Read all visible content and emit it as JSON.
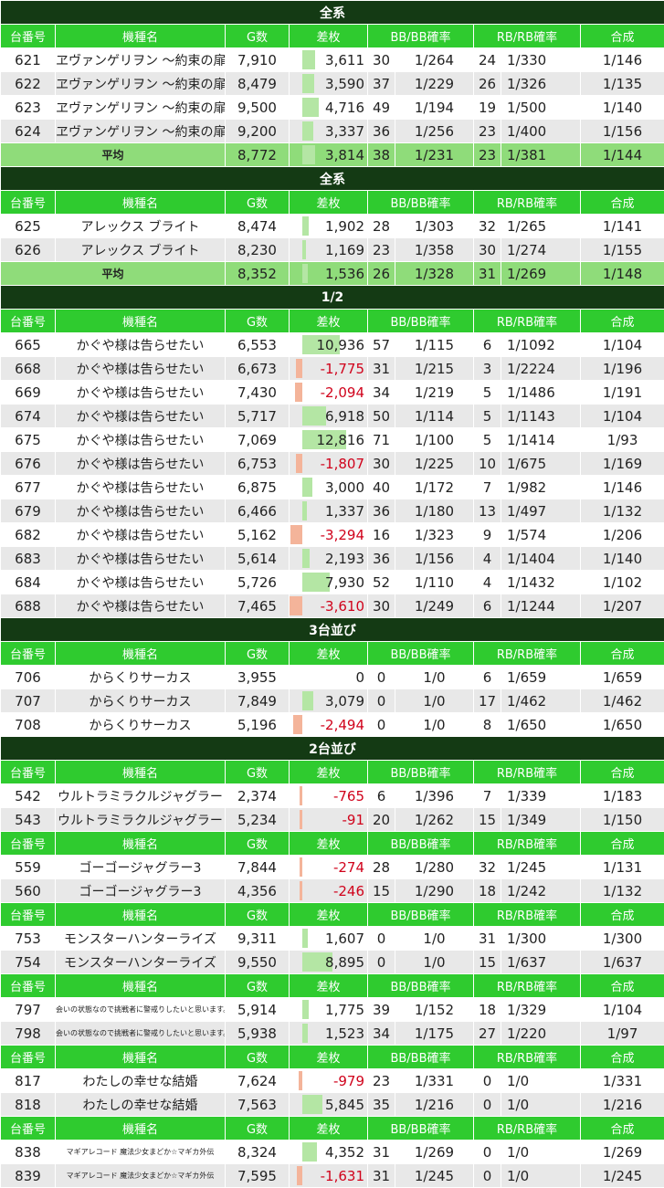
{
  "headers": [
    "台番号",
    "機種名",
    "G数",
    "差枚",
    "BB/BB確率",
    "RB/RB確率",
    "合成"
  ],
  "diff_scale_max": 12816,
  "sections": [
    {
      "title": "全系",
      "groups": [
        {
          "rows": [
            [
              "621",
              "ヱヴァンゲリヲン ～約束の扉～",
              "7,910",
              "3,611",
              "30",
              "1/264",
              "24",
              "1/330",
              "1/146"
            ],
            [
              "622",
              "ヱヴァンゲリヲン ～約束の扉～",
              "8,479",
              "3,590",
              "37",
              "1/229",
              "26",
              "1/326",
              "1/135"
            ],
            [
              "623",
              "ヱヴァンゲリヲン ～約束の扉～",
              "9,500",
              "4,716",
              "49",
              "1/194",
              "19",
              "1/500",
              "1/140"
            ],
            [
              "624",
              "ヱヴァンゲリヲン ～約束の扉～",
              "9,200",
              "3,337",
              "36",
              "1/256",
              "23",
              "1/400",
              "1/156"
            ]
          ]
        }
      ],
      "avg": [
        "平均",
        "8,772",
        "3,814",
        "38",
        "1/231",
        "23",
        "1/381",
        "1/144"
      ]
    },
    {
      "title": "全系",
      "groups": [
        {
          "rows": [
            [
              "625",
              "アレックス ブライト",
              "8,474",
              "1,902",
              "28",
              "1/303",
              "32",
              "1/265",
              "1/141"
            ],
            [
              "626",
              "アレックス ブライト",
              "8,230",
              "1,169",
              "23",
              "1/358",
              "30",
              "1/274",
              "1/155"
            ]
          ]
        }
      ],
      "avg": [
        "平均",
        "8,352",
        "1,536",
        "26",
        "1/328",
        "31",
        "1/269",
        "1/148"
      ]
    },
    {
      "title": "1/2",
      "groups": [
        {
          "rows": [
            [
              "665",
              "かぐや様は告らせたい",
              "6,553",
              "10,936",
              "57",
              "1/115",
              "6",
              "1/1092",
              "1/104"
            ],
            [
              "668",
              "かぐや様は告らせたい",
              "6,673",
              "-1,775",
              "31",
              "1/215",
              "3",
              "1/2224",
              "1/196"
            ],
            [
              "669",
              "かぐや様は告らせたい",
              "7,430",
              "-2,094",
              "34",
              "1/219",
              "5",
              "1/1486",
              "1/191"
            ],
            [
              "674",
              "かぐや様は告らせたい",
              "5,717",
              "6,918",
              "50",
              "1/114",
              "5",
              "1/1143",
              "1/104"
            ],
            [
              "675",
              "かぐや様は告らせたい",
              "7,069",
              "12,816",
              "71",
              "1/100",
              "5",
              "1/1414",
              "1/93"
            ],
            [
              "676",
              "かぐや様は告らせたい",
              "6,753",
              "-1,807",
              "30",
              "1/225",
              "10",
              "1/675",
              "1/169"
            ],
            [
              "677",
              "かぐや様は告らせたい",
              "6,875",
              "3,000",
              "40",
              "1/172",
              "7",
              "1/982",
              "1/146"
            ],
            [
              "679",
              "かぐや様は告らせたい",
              "6,466",
              "1,337",
              "36",
              "1/180",
              "13",
              "1/497",
              "1/132"
            ],
            [
              "682",
              "かぐや様は告らせたい",
              "5,162",
              "-3,294",
              "16",
              "1/323",
              "9",
              "1/574",
              "1/206"
            ],
            [
              "683",
              "かぐや様は告らせたい",
              "5,614",
              "2,193",
              "36",
              "1/156",
              "4",
              "1/1404",
              "1/140"
            ],
            [
              "684",
              "かぐや様は告らせたい",
              "5,726",
              "7,930",
              "52",
              "1/110",
              "4",
              "1/1432",
              "1/102"
            ],
            [
              "688",
              "かぐや様は告らせたい",
              "7,465",
              "-3,610",
              "30",
              "1/249",
              "6",
              "1/1244",
              "1/207"
            ]
          ]
        }
      ]
    },
    {
      "title": "3台並び",
      "groups": [
        {
          "rows": [
            [
              "706",
              "からくりサーカス",
              "3,955",
              "0",
              "0",
              "1/0",
              "6",
              "1/659",
              "1/659"
            ],
            [
              "707",
              "からくりサーカス",
              "7,849",
              "3,079",
              "0",
              "1/0",
              "17",
              "1/462",
              "1/462"
            ],
            [
              "708",
              "からくりサーカス",
              "5,196",
              "-2,494",
              "0",
              "1/0",
              "8",
              "1/650",
              "1/650"
            ]
          ]
        }
      ]
    },
    {
      "title": "2台並び",
      "groups": [
        {
          "rows": [
            [
              "542",
              "ウルトラミラクルジャグラー",
              "2,374",
              "-765",
              "6",
              "1/396",
              "7",
              "1/339",
              "1/183"
            ],
            [
              "543",
              "ウルトラミラクルジャグラー",
              "5,234",
              "-91",
              "20",
              "1/262",
              "15",
              "1/349",
              "1/150"
            ]
          ]
        },
        {
          "rows": [
            [
              "559",
              "ゴーゴージャグラー3",
              "7,844",
              "-274",
              "28",
              "1/280",
              "32",
              "1/245",
              "1/131"
            ],
            [
              "560",
              "ゴーゴージャグラー3",
              "4,356",
              "-246",
              "15",
              "1/290",
              "18",
              "1/242",
              "1/132"
            ]
          ]
        },
        {
          "rows": [
            [
              "753",
              "モンスターハンターライズ",
              "9,311",
              "1,607",
              "0",
              "1/0",
              "31",
              "1/300",
              "1/300"
            ],
            [
              "754",
              "モンスターハンターライズ",
              "9,550",
              "8,895",
              "0",
              "1/0",
              "15",
              "1/637",
              "1/637"
            ]
          ]
        },
        {
          "tiny": true,
          "rows": [
            [
              "797",
              "会いの状態なので挑戦者に警戒りしたいと思います。",
              "5,914",
              "1,775",
              "39",
              "1/152",
              "18",
              "1/329",
              "1/104"
            ],
            [
              "798",
              "会いの状態なので挑戦者に警戒りしたいと思います。",
              "5,938",
              "1,523",
              "34",
              "1/175",
              "27",
              "1/220",
              "1/97"
            ]
          ]
        },
        {
          "rows": [
            [
              "817",
              "わたしの幸せな結婚",
              "7,624",
              "-979",
              "23",
              "1/331",
              "0",
              "1/0",
              "1/331"
            ],
            [
              "818",
              "わたしの幸せな結婚",
              "7,563",
              "5,845",
              "35",
              "1/216",
              "0",
              "1/0",
              "1/216"
            ]
          ]
        },
        {
          "tiny": true,
          "rows": [
            [
              "838",
              "マギアレコード 魔法少女まどか☆マギカ外伝",
              "8,324",
              "4,352",
              "31",
              "1/269",
              "0",
              "1/0",
              "1/269"
            ],
            [
              "839",
              "マギアレコード 魔法少女まどか☆マギカ外伝",
              "7,595",
              "-1,631",
              "31",
              "1/245",
              "0",
              "1/0",
              "1/245"
            ]
          ]
        }
      ]
    }
  ]
}
